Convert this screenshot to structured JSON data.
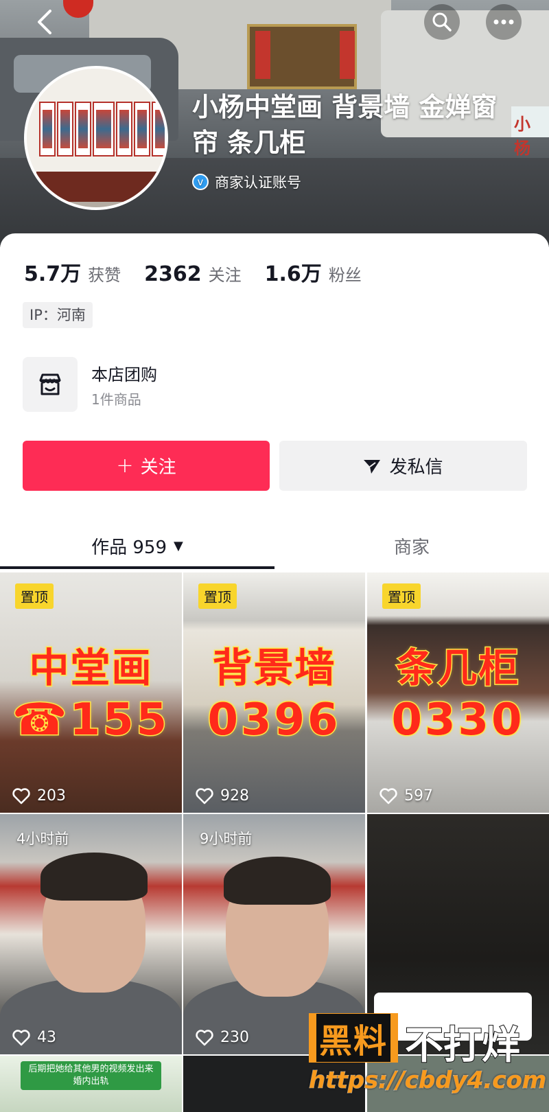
{
  "header": {
    "profile_name": "小杨中堂画 背景墙 金婵窗帘 条几柜",
    "verify_label": "商家认证账号",
    "truck_sign": "小杨",
    "icons": {
      "back": "chevron-left-icon",
      "search": "search-icon",
      "more": "more-icon"
    }
  },
  "stats": [
    {
      "value": "5.7万",
      "label": "获赞"
    },
    {
      "value": "2362",
      "label": "关注"
    },
    {
      "value": "1.6万",
      "label": "粉丝"
    }
  ],
  "ip_tag": "IP：河南",
  "shop": {
    "title": "本店团购",
    "subtitle": "1件商品"
  },
  "actions": {
    "follow_plus": "+",
    "follow_label": "关注",
    "message_label": "发私信"
  },
  "tabs": {
    "works_label": "作品 959",
    "works_caret": "▼",
    "shop_label": "商家"
  },
  "grid": [
    {
      "badge": "置顶",
      "title": "中堂画",
      "number": "☎155",
      "likes": "203"
    },
    {
      "badge": "置顶",
      "title": "背景墙",
      "number": "0396",
      "likes": "928"
    },
    {
      "badge": "置顶",
      "title": "条几柜",
      "number": "0330",
      "likes": "597"
    },
    {
      "time": "4小时前",
      "likes": "43"
    },
    {
      "time": "9小时前",
      "likes": "230"
    },
    {
      "likes": ""
    }
  ],
  "bottom_caption": "后期把她给其他男的视频发出来 婚内出轨",
  "watermark": {
    "black": "黑料",
    "tagline": "不打烊",
    "url": "https://cbdy4.com"
  },
  "colors": {
    "primary": "#fe2c55",
    "pin": "#f8d52c",
    "verify": "#2f9cf0"
  }
}
